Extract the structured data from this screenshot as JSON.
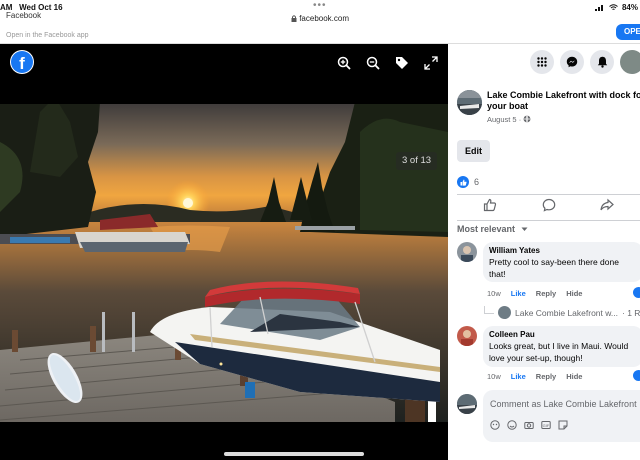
{
  "status_bar": {
    "time": "AM",
    "date": "Wed Oct 16",
    "battery": "84%"
  },
  "browser": {
    "url": "facebook.com",
    "banner_title": "Facebook",
    "banner_subtitle": "Open in the Facebook app",
    "open_label": "OPE"
  },
  "viewer": {
    "photo_counter": "3 of 13",
    "icons": [
      "zoom-in-icon",
      "zoom-out-icon",
      "tag-icon",
      "fullscreen-icon"
    ]
  },
  "panel": {
    "top_icons": [
      "menu-grid-icon",
      "messenger-icon",
      "notifications-bell-icon",
      "profile-avatar"
    ],
    "post": {
      "title": "Lake Combie Lakefront with dock for your boat",
      "date": "August 5 ·",
      "edit_label": "Edit",
      "like_count": "6"
    },
    "sort_label": "Most relevant",
    "comments": [
      {
        "name": "William Yates",
        "text": "Pretty cool to say-been there done that!",
        "time": "10w",
        "like": "Like",
        "reply": "Reply",
        "hide": "Hide"
      },
      {
        "name": "Colleen Pau",
        "text": "Looks great, but I live in Maui. Would love your set-up, though!",
        "time": "10w",
        "like": "Like",
        "reply": "Reply",
        "hide": "Hide"
      }
    ],
    "reply_preview": "Lake Combie Lakefront w...",
    "reply_count": "· 1 R",
    "composer_placeholder": "Comment as Lake Combie Lakefront"
  },
  "colors": {
    "brand_blue": "#1877f2",
    "panel_bg": "#ffffff",
    "viewer_bg": "#000000"
  }
}
